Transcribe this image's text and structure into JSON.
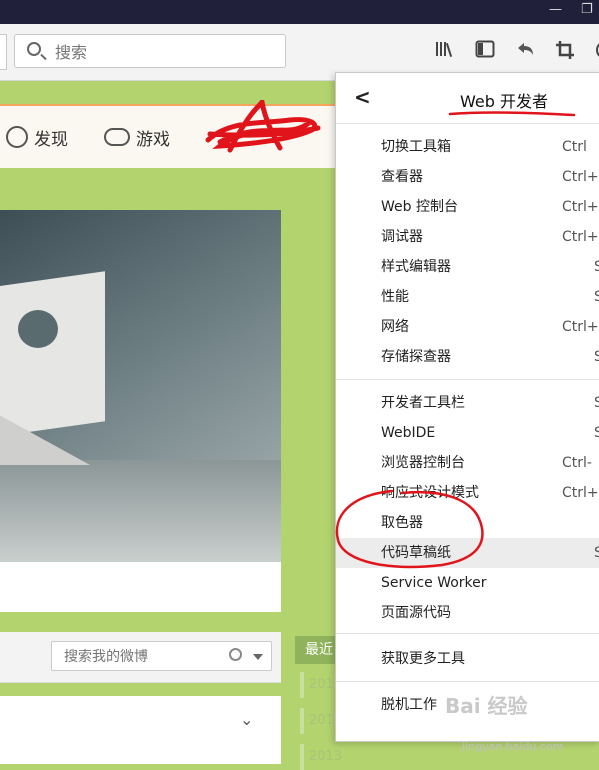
{
  "toolbar": {
    "search_placeholder": "搜索",
    "icons": [
      "library-icon",
      "sidebar-icon",
      "back-icon",
      "crop-icon",
      "developer-icon"
    ]
  },
  "sitenav": {
    "items": [
      {
        "label": "发现",
        "icon": "compass-icon"
      },
      {
        "label": "游戏",
        "icon": "gamepad-icon"
      }
    ]
  },
  "feed": {
    "search_placeholder": "搜索我的微博",
    "recent_label": "最近",
    "years": [
      "2016",
      "2015",
      "2013"
    ]
  },
  "devmenu": {
    "title": "Web 开发者",
    "group1": [
      {
        "label": "切换工具箱",
        "shortcut": "Ctrl"
      },
      {
        "label": "查看器",
        "shortcut": "Ctrl+"
      },
      {
        "label": "Web 控制台",
        "shortcut": "Ctrl+"
      },
      {
        "label": "调试器",
        "shortcut": "Ctrl+"
      },
      {
        "label": "样式编辑器",
        "shortcut": "S"
      },
      {
        "label": "性能",
        "shortcut": "S"
      },
      {
        "label": "网络",
        "shortcut": "Ctrl+"
      },
      {
        "label": "存储探查器",
        "shortcut": "S"
      }
    ],
    "group2": [
      {
        "label": "开发者工具栏",
        "shortcut": "S"
      },
      {
        "label": "WebIDE",
        "shortcut": "S"
      },
      {
        "label": "浏览器控制台",
        "shortcut": "Ctrl-"
      },
      {
        "label": "响应式设计模式",
        "shortcut": "Ctrl+"
      },
      {
        "label": "取色器",
        "shortcut": ""
      },
      {
        "label": "代码草稿纸",
        "shortcut": "S"
      },
      {
        "label": "Service Worker",
        "shortcut": ""
      },
      {
        "label": "页面源代码",
        "shortcut": ""
      }
    ],
    "group3": [
      {
        "label": "获取更多工具",
        "shortcut": ""
      }
    ],
    "group4": [
      {
        "label": "脱机工作",
        "shortcut": ""
      }
    ]
  },
  "watermark": {
    "text": "Bai 经验",
    "url": "jingyan.baidu.com"
  },
  "colors": {
    "annotation": "#e0141a",
    "page_bg": "#b3d36f",
    "nav_accent": "#f5a55e"
  }
}
